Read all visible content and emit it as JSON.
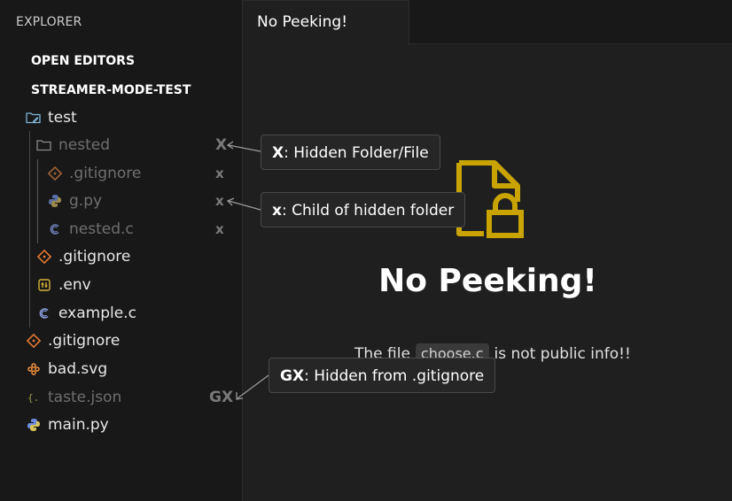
{
  "sidebar": {
    "title": "EXPLORER",
    "open_editors": "OPEN EDITORS",
    "project": "STREAMER-MODE-TEST",
    "items": [
      {
        "label": "test",
        "icon": "folder-edit-icon"
      },
      {
        "label": "nested",
        "icon": "folder-icon"
      },
      {
        "label": ".gitignore",
        "icon": "git-icon"
      },
      {
        "label": "g.py",
        "icon": "python-icon"
      },
      {
        "label": "nested.c",
        "icon": "c-icon"
      },
      {
        "label": ".gitignore",
        "icon": "git-icon"
      },
      {
        "label": ".env",
        "icon": "env-icon"
      },
      {
        "label": "example.c",
        "icon": "c-icon"
      },
      {
        "label": ".gitignore",
        "icon": "git-icon"
      },
      {
        "label": "bad.svg",
        "icon": "svg-icon"
      },
      {
        "label": "taste.json",
        "icon": "json-icon"
      },
      {
        "label": "main.py",
        "icon": "python-icon"
      }
    ],
    "markers": {
      "hidden": "X",
      "child": "x",
      "gitignore": "GX"
    }
  },
  "editor": {
    "tab_label": "No Peeking!",
    "heading": "No Peeking!",
    "message_before": "The file",
    "file_chip": "choose.c",
    "message_after": "is not public info!!"
  },
  "callouts": [
    {
      "key": "X",
      "text": ": Hidden Folder/File"
    },
    {
      "key": "x",
      "text": ": Child of hidden folder"
    },
    {
      "key": "GX",
      "text": ": Hidden from .gitignore"
    }
  ],
  "colors": {
    "lock_accent": "#c9a400",
    "git_orange": "#e37933",
    "python_blue": "#6d8ce0",
    "c_blue": "#8b9ee0",
    "json_yellow": "#cbcb41",
    "env_yellow": "#d6b33b",
    "svg_orange": "#f2913d"
  }
}
